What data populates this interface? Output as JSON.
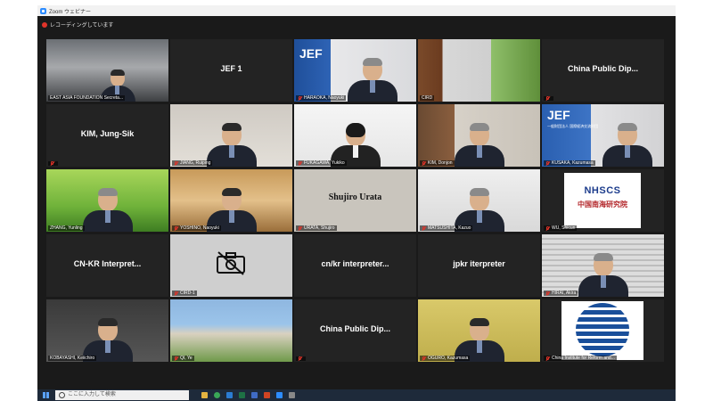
{
  "window": {
    "title": "Zoom ウェビナー"
  },
  "recording": {
    "label": "レコーディングしています"
  },
  "taskbar": {
    "search_placeholder": "ここに入力して検索"
  },
  "tiles": [
    {
      "label": "EAST ASIA FOUNDATION Secreta...",
      "center": ""
    },
    {
      "label": "",
      "center": "JEF 1"
    },
    {
      "label": "HARAOKA, Naoyuki",
      "center": ""
    },
    {
      "label": "CIRD",
      "center": ""
    },
    {
      "label": "",
      "center": "China Public Dip..."
    },
    {
      "label": "",
      "center": "KIM, Jung-Sik"
    },
    {
      "label": "JIANG, Ruiping",
      "center": ""
    },
    {
      "label": "FUKAGAWA, Yukiko",
      "center": ""
    },
    {
      "label": "KIM, Donjon",
      "center": ""
    },
    {
      "label": "KUSAKA, Kazumasa",
      "center": ""
    },
    {
      "label": "ZHANG, Yunling",
      "center": ""
    },
    {
      "label": "YOSHINO, Naoyuki",
      "center": ""
    },
    {
      "label": "URATA, Shujiro",
      "center": ""
    },
    {
      "label": "MATSUSHITA, Kazuo",
      "center": ""
    },
    {
      "label": "WU, Shicun",
      "center": ""
    },
    {
      "label": "",
      "center": "CN-KR Interpret..."
    },
    {
      "label": "CIRD-1",
      "center": ""
    },
    {
      "label": "",
      "center": "cn/kr interpreter..."
    },
    {
      "label": "",
      "center": "jpkr iterpreter"
    },
    {
      "label": "HIRAI, Akira",
      "center": ""
    },
    {
      "label": "KOBAYASHI, Keiichiro",
      "center": ""
    },
    {
      "label": "QI, Ye",
      "center": ""
    },
    {
      "label": "",
      "center": "China Public Dip..."
    },
    {
      "label": "OGURO, Kazumasa",
      "center": ""
    },
    {
      "label": "China Institute for Reform and...",
      "center": ""
    }
  ],
  "logos": {
    "jef": "JEF",
    "jef_sub": "一般財団法人 国際経済交流財団",
    "urata_sign": "Shujiro Urata",
    "nhscs": "NHSCS",
    "nhscs_sub": "中国南海研究院"
  },
  "colors": {
    "mute_red": "#e0342a",
    "recording_red": "#e0342a",
    "zoom_blue": "#2d8cff",
    "tile_bg": "#232323"
  }
}
